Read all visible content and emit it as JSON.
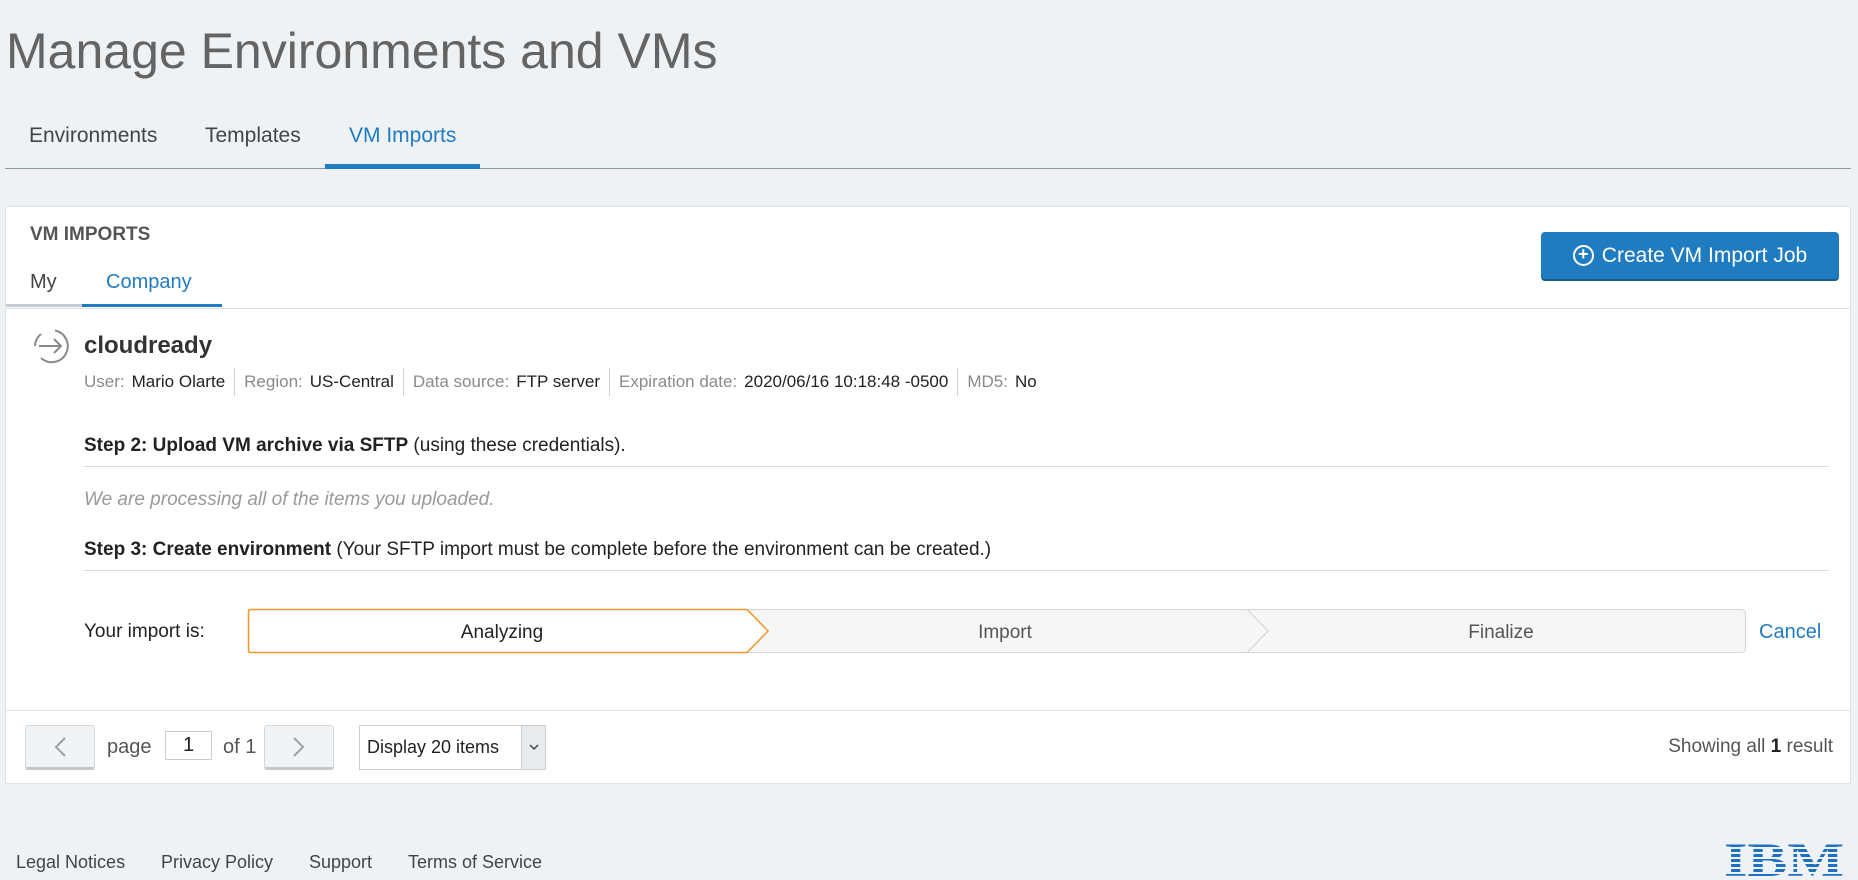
{
  "page": {
    "title": "Manage Environments and VMs"
  },
  "main_tabs": [
    {
      "label": "Environments",
      "active": false
    },
    {
      "label": "Templates",
      "active": false
    },
    {
      "label": "VM Imports",
      "active": true
    }
  ],
  "section": {
    "title": "VM IMPORTS",
    "sub_tabs": [
      {
        "label": "My",
        "active": false
      },
      {
        "label": "Company",
        "active": true
      }
    ],
    "create_button": {
      "label": "Create VM Import Job",
      "icon": "plus-circle-icon"
    }
  },
  "import_item": {
    "icon": "import-arrow-icon",
    "name": "cloudready",
    "meta": [
      {
        "label": "User:",
        "value": "Mario Olarte"
      },
      {
        "label": "Region:",
        "value": "US-Central"
      },
      {
        "label": "Data source:",
        "value": "FTP server"
      },
      {
        "label": "Expiration date:",
        "value": "2020/06/16 10:18:48 -0500"
      },
      {
        "label": "MD5:",
        "value": "No"
      }
    ],
    "step2": {
      "bold": "Step 2: Upload VM archive via SFTP",
      "rest": " (using these credentials)."
    },
    "processing_message": "We are processing all of the items you uploaded.",
    "step3": {
      "bold": "Step 3: Create environment",
      "rest": " (Your SFTP import must be complete before the environment can be created.)"
    },
    "progress": {
      "label": "Your import is:",
      "stages": [
        "Analyzing",
        "Import",
        "Finalize"
      ],
      "current_stage": "Analyzing"
    },
    "cancel_label": "Cancel"
  },
  "pagination": {
    "page_label": "page",
    "page_value": "1",
    "of_label": "of 1",
    "display_select": "Display 20 items",
    "showing_prefix": "Showing all",
    "showing_count": "1",
    "showing_suffix": "result"
  },
  "footer": {
    "links": [
      "Legal Notices",
      "Privacy Policy",
      "Support",
      "Terms of Service"
    ],
    "logo": "IBM"
  },
  "colors": {
    "accent": "#1f7cc1",
    "active_stage_border": "#f0962a",
    "background": "#eff2f4"
  }
}
